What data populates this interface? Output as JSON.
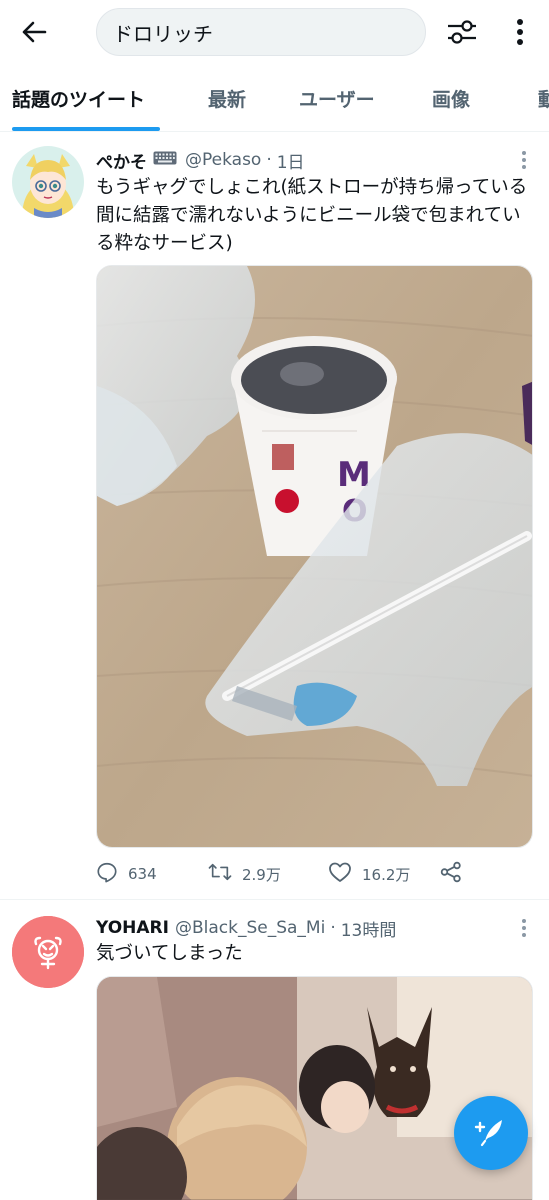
{
  "search": {
    "query": "ドロリッチ"
  },
  "tabs": [
    {
      "label": "話題のツイート",
      "active": true
    },
    {
      "label": "最新"
    },
    {
      "label": "ユーザー"
    },
    {
      "label": "画像"
    },
    {
      "label": "動"
    }
  ],
  "tweets": [
    {
      "name": "ぺかそ",
      "name_emoji": "keyboard-icon",
      "handle": "@Pekaso",
      "dot": "·",
      "time": "1日",
      "text": "もうギャグでしょこれ(紙ストローが持ち帰っている間に結露で濡れないようにビニール袋で包まれている粋なサービス)",
      "replies": "634",
      "retweets": "2.9万",
      "likes": "16.2万"
    },
    {
      "name": "YOHARI",
      "handle": "@Black_Se_Sa_Mi",
      "dot": "·",
      "time": "13時間",
      "text": "気づいてしまった"
    }
  ],
  "colors": {
    "accent": "#1d9bf0",
    "avatar2_bg": "#f4797a"
  },
  "icons": [
    "back-arrow-icon",
    "filter-sliders-icon",
    "more-vertical-icon",
    "reply-icon",
    "retweet-icon",
    "like-icon",
    "share-icon",
    "compose-tweet-icon"
  ]
}
